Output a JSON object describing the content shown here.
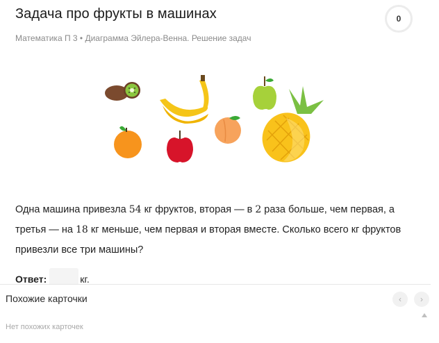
{
  "card": {
    "title": "Задача про фрукты в машинах",
    "breadcrumb": "Математика П 3 • Диаграмма Эйлера-Венна. Решение задач",
    "score": "0",
    "problem": {
      "part1": "Одна машина привезла ",
      "n1": "54",
      "part2": " кг фруктов, вторая — в ",
      "n2": "2",
      "part3": " раза больше, чем первая, а третья — на ",
      "n3": "18",
      "part4": " кг меньше, чем первая и вторая вместе. Сколько всего кг фруктов привезли все три машины?"
    },
    "answer": {
      "label": "Ответ:",
      "value": "",
      "unit": "кг."
    }
  },
  "similar": {
    "title": "Похожие карточки",
    "prev_icon": "chevron-left-icon",
    "next_icon": "chevron-right-icon",
    "prev_glyph": "‹",
    "next_glyph": "›",
    "empty_text": "Нет похожих карточек"
  },
  "colors": {
    "kiwi": "#7b4a2e",
    "kiwi_flesh": "#8cc63f",
    "banana": "#f5c518",
    "apple_green": "#a6d13a",
    "orange": "#f7941d",
    "apple_red": "#d7142a",
    "peach": "#f7a35c",
    "pineapple": "#f9c21b",
    "leaf": "#3aa935"
  }
}
